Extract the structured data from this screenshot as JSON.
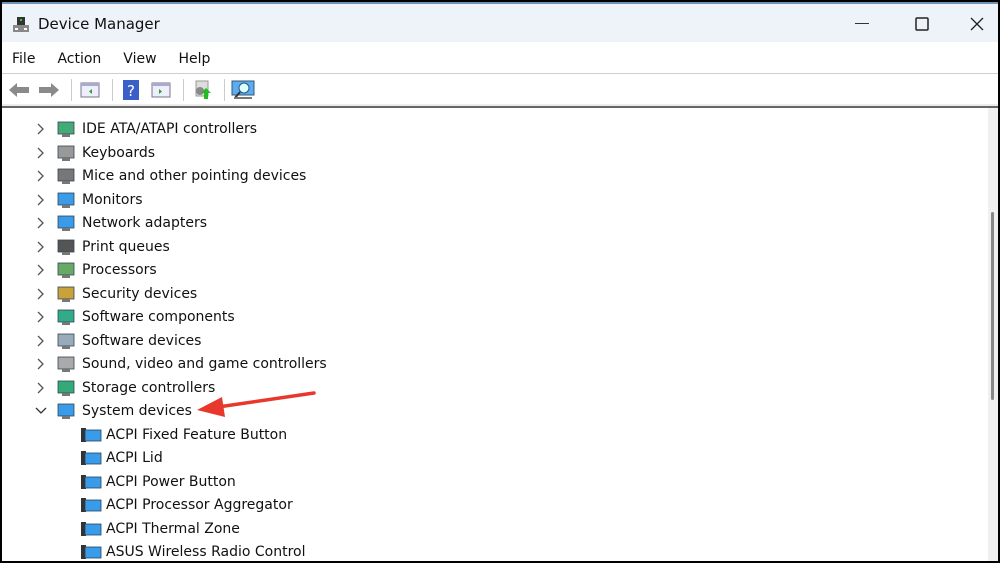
{
  "window": {
    "title": "Device Manager"
  },
  "menu": [
    "File",
    "Action",
    "View",
    "Help"
  ],
  "toolbar": [
    "back-icon",
    "forward-icon",
    "show-hide-console-tree-icon",
    "help-icon",
    "action-pane-icon",
    "update-driver-icon",
    "scan-hardware-icon"
  ],
  "tree": {
    "categories": [
      {
        "label": "IDE ATA/ATAPI controllers",
        "icon": "ide-controller-icon",
        "expanded": false
      },
      {
        "label": "Keyboards",
        "icon": "keyboard-icon",
        "expanded": false
      },
      {
        "label": "Mice and other pointing devices",
        "icon": "mouse-icon",
        "expanded": false
      },
      {
        "label": "Monitors",
        "icon": "monitor-icon",
        "expanded": false
      },
      {
        "label": "Network adapters",
        "icon": "network-icon",
        "expanded": false
      },
      {
        "label": "Print queues",
        "icon": "printer-icon",
        "expanded": false
      },
      {
        "label": "Processors",
        "icon": "processor-icon",
        "expanded": false
      },
      {
        "label": "Security devices",
        "icon": "security-icon",
        "expanded": false
      },
      {
        "label": "Software components",
        "icon": "software-component-icon",
        "expanded": false
      },
      {
        "label": "Software devices",
        "icon": "software-device-icon",
        "expanded": false
      },
      {
        "label": "Sound, video and game controllers",
        "icon": "speaker-icon",
        "expanded": false
      },
      {
        "label": "Storage controllers",
        "icon": "storage-icon",
        "expanded": false
      },
      {
        "label": "System devices",
        "icon": "system-device-icon",
        "expanded": true
      }
    ],
    "children": [
      "ACPI Fixed Feature Button",
      "ACPI Lid",
      "ACPI Power Button",
      "ACPI Processor Aggregator",
      "ACPI Thermal Zone",
      "ASUS Wireless Radio Control"
    ]
  },
  "annotation": {
    "color": "#e8372c",
    "points_to": "System devices"
  }
}
